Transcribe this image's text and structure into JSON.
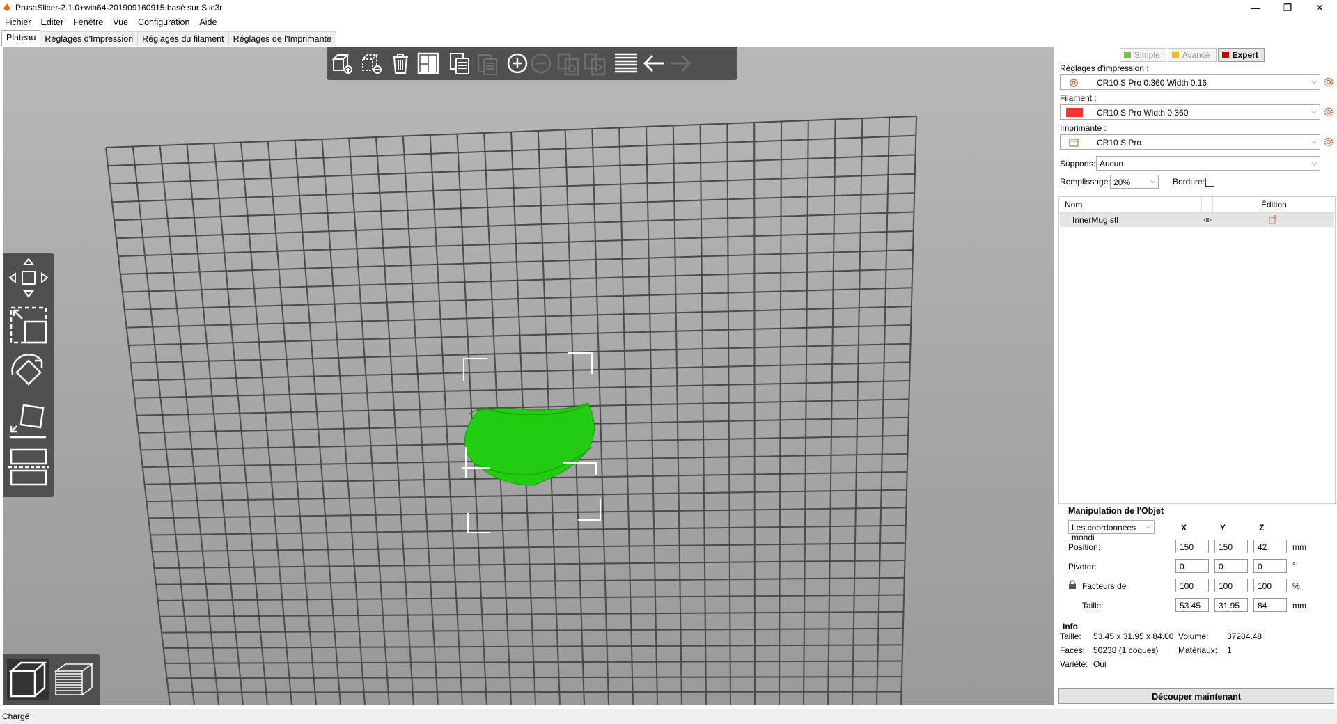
{
  "window": {
    "title": "PrusaSlicer-2.1.0+win64-201909160915 basé sur Slic3r",
    "controls": {
      "minimize": "—",
      "maximize": "❐",
      "close": "✕"
    }
  },
  "menu": [
    "Fichier",
    "Editer",
    "Fenêtre",
    "Vue",
    "Configuration",
    "Aide"
  ],
  "tabs": [
    "Plateau",
    "Réglages d'Impression",
    "Réglages du filament",
    "Réglages de l'Imprimante"
  ],
  "toolbar_icons": [
    "add-icon",
    "delete-icon",
    "delete-all-icon",
    "arrange-icon",
    "copy-icon",
    "paste-icon",
    "increase-instances-icon",
    "decrease-instances-icon",
    "split-objects-icon",
    "split-parts-icon",
    "layer-editing-icon",
    "undo-icon",
    "redo-icon"
  ],
  "side_tools": [
    "move-icon",
    "scale-icon",
    "rotate-icon",
    "place-on-face-icon",
    "cut-icon"
  ],
  "mode_buttons": [
    {
      "label": "Simple",
      "color": "#7ac142"
    },
    {
      "label": "Avancé",
      "color": "#f0c000"
    },
    {
      "label": "Expert",
      "color": "#c00000"
    }
  ],
  "settings": {
    "print_label": "Réglages d'impression :",
    "print_value": "CR10 S Pro 0.360 Width 0.16",
    "filament_label": "Filament :",
    "filament_value": "CR10 S Pro Width 0.360",
    "filament_color": "#ff3030",
    "printer_label": "Imprimante :",
    "printer_value": "CR10 S Pro",
    "supports_label": "Supports:",
    "supports_value": "Aucun",
    "infill_label": "Remplissage:",
    "infill_value": "20%",
    "brim_label": "Bordure:"
  },
  "object_list": {
    "col_name": "Nom",
    "col_edit": "Édition",
    "items": [
      {
        "name": "InnerMug.stl"
      }
    ]
  },
  "manipulation": {
    "title": "Manipulation de l'Objet",
    "coord_select": "Les coordonnées mondi",
    "axes": [
      "X",
      "Y",
      "Z"
    ],
    "position_label": "Position:",
    "position": [
      "150",
      "150",
      "42"
    ],
    "position_unit": "mm",
    "rotate_label": "Pivoter:",
    "rotate": [
      "0",
      "0",
      "0"
    ],
    "rotate_unit": "°",
    "scale_label": "Facteurs de",
    "scale": [
      "100",
      "100",
      "100"
    ],
    "scale_unit": "%",
    "size_label": "Taille:",
    "size": [
      "53.45",
      "31.95",
      "84"
    ],
    "size_unit": "mm"
  },
  "info": {
    "title": "Info",
    "size_label": "Taille:",
    "size_value": "53.45 x 31.95 x 84.00",
    "volume_label": "Volume:",
    "volume_value": "37284.48",
    "faces_label": "Faces:",
    "faces_value": "50238 (1 coques)",
    "materials_label": "Matériaux:",
    "materials_value": "1",
    "manifold_label": "Variété:",
    "manifold_value": "Oui"
  },
  "slice_button": "Découper maintenant",
  "status": "Chargé",
  "object_color": "#22cc11"
}
